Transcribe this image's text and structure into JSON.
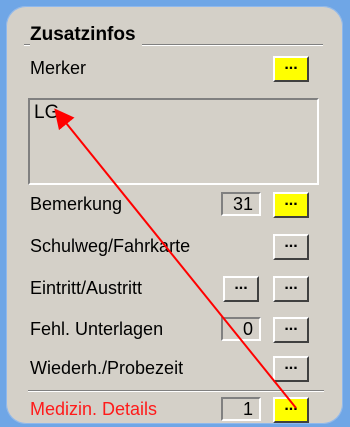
{
  "group": {
    "title": "Zusatzinfos"
  },
  "merker": {
    "label": "Merker",
    "button": "..."
  },
  "memo": {
    "text": "LG"
  },
  "bemerkung": {
    "label": "Bemerkung",
    "count": "31",
    "button": "..."
  },
  "schulweg": {
    "label": "Schulweg/Fahrkarte",
    "button": "..."
  },
  "eintritt": {
    "label": "Eintritt/Austritt",
    "button1": "...",
    "button2": "..."
  },
  "fehl": {
    "label": "Fehl. Unterlagen",
    "count": "0",
    "button": "..."
  },
  "wiederh": {
    "label": "Wiederh./Probezeit",
    "button": "..."
  },
  "medizin": {
    "label": "Medizin. Details",
    "count": "1",
    "button": "..."
  },
  "colors": {
    "highlight_button": "#ffff00",
    "alert_label": "#ff1a1a",
    "annotation_arrow": "#ff0000"
  }
}
